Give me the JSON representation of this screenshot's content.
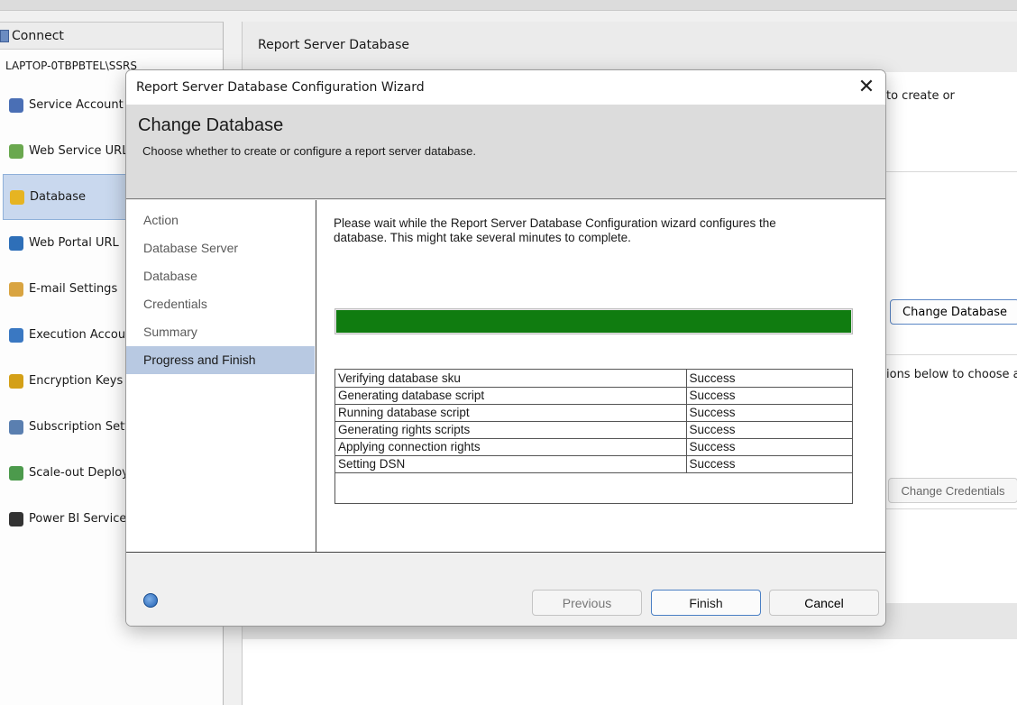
{
  "left_pane": {
    "connect_label": "Connect",
    "server_name": "LAPTOP-0TBPBTEL\\SSRS",
    "nav_items": [
      {
        "label": "Service Account",
        "icon": "service-account-icon",
        "color": "#4a6fb5"
      },
      {
        "label": "Web Service URL",
        "icon": "web-service-icon",
        "color": "#6aa84f"
      },
      {
        "label": "Database",
        "icon": "database-icon",
        "color": "#e6b422",
        "active": true
      },
      {
        "label": "Web Portal URL",
        "icon": "globe-icon",
        "color": "#2e6fb8"
      },
      {
        "label": "E-mail Settings",
        "icon": "email-icon",
        "color": "#d9a441"
      },
      {
        "label": "Execution Account",
        "icon": "user-account-icon",
        "color": "#3a78c2"
      },
      {
        "label": "Encryption Keys",
        "icon": "key-icon",
        "color": "#d4a017"
      },
      {
        "label": "Subscription Settings",
        "icon": "subscription-icon",
        "color": "#5a7fb0"
      },
      {
        "label": "Scale-out Deployment",
        "icon": "network-icon",
        "color": "#4c9a4c"
      },
      {
        "label": "Power BI Service (cloud)",
        "icon": "chart-icon",
        "color": "#333333"
      }
    ]
  },
  "right_pane": {
    "title": "Report Server Database",
    "text1": "to create or",
    "button1": "Change Database",
    "text2": "ions below to choose a",
    "button2": "Change Credentials"
  },
  "dialog": {
    "title": "Report Server Database Configuration Wizard",
    "close_glyph": "✕",
    "heading": "Change Database",
    "subheading": "Choose whether to create or configure a report server database.",
    "steps": [
      "Action",
      "Database Server",
      "Database",
      "Credentials",
      "Summary",
      "Progress and Finish"
    ],
    "active_step": "Progress and Finish",
    "message": "Please wait while the Report Server Database Configuration wizard configures the database.  This might take several minutes to complete.",
    "progress": 1.0,
    "results": [
      {
        "task": "Verifying database sku",
        "status": "Success"
      },
      {
        "task": "Generating database script",
        "status": "Success"
      },
      {
        "task": "Running database script",
        "status": "Success"
      },
      {
        "task": "Generating rights scripts",
        "status": "Success"
      },
      {
        "task": "Applying connection rights",
        "status": "Success"
      },
      {
        "task": "Setting DSN",
        "status": "Success"
      }
    ],
    "buttons": {
      "previous": "Previous",
      "finish": "Finish",
      "cancel": "Cancel"
    }
  },
  "colors": {
    "progress_fill": "#107c10",
    "active_step_bg": "#b8c9e2",
    "active_nav_bg": "#c9d8ee"
  }
}
